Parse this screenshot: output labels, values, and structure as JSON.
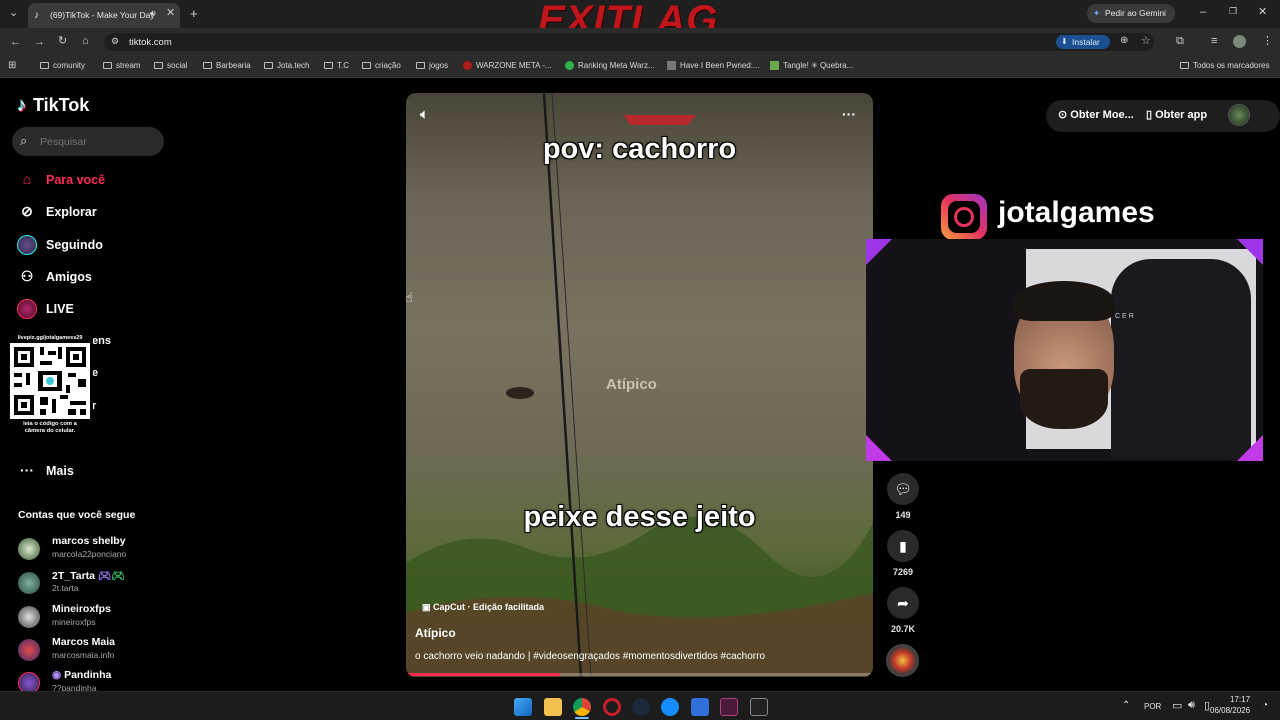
{
  "browser": {
    "tab_title": "(69)TikTok - Make Your Day",
    "url": "tiktok.com",
    "install_label": "Instalar",
    "gemini_label": "Pedir ao Gemini",
    "bookmarks": [
      "comunity",
      "stream",
      "social",
      "Barbearia",
      "Jota.tech",
      "T.C",
      "criação",
      "jogos",
      "WARZONE META -...",
      "Ranking Meta Warz...",
      "Have I Been Pwned:...",
      "Tangle! ✳ Quebra..."
    ],
    "all_bookmarks_label": "Todos os marcadores"
  },
  "overlay": {
    "brand_logo": "EXITLAG",
    "instagram_handle": "jotalgames",
    "webcam_cam_text": "CER",
    "qr_url": "livepix.gg/jotalgamess29",
    "qr_caption": "leia o código com a câmera do celular."
  },
  "sidebar": {
    "logo_text": "TikTok",
    "search_placeholder": "Pesquisar",
    "nav": {
      "for_you": "Para você",
      "explore": "Explorar",
      "following": "Seguindo",
      "friends": "Amigos",
      "live": "LIVE",
      "partial_1": "ens",
      "partial_2": "e",
      "partial_3": "r",
      "more": "Mais"
    },
    "following_title": "Contas que você segue",
    "accounts": [
      {
        "name": "marcos shelby",
        "handle": "marcola22ponciano"
      },
      {
        "name": "2T_Tarta",
        "handle": "2t.tarta"
      },
      {
        "name": "Mineiroxfps",
        "handle": "mineiroxfps"
      },
      {
        "name": "Marcos Maia",
        "handle": "marcosmaia.info"
      },
      {
        "name": "Pandinha",
        "handle": "??pandinha"
      }
    ]
  },
  "header_right": {
    "coins_label": "Obter Moe...",
    "app_label": "Obter app"
  },
  "video": {
    "caption_top": "pov: cachorro",
    "caption_bottom": "peixe desse jeito",
    "watermark": "Atípico",
    "capcut_label": "CapCut · Edição facilitada",
    "author": "Atípico",
    "description": "o cachorro veio nadando | #videosengraçados #momentosdivertidos #cachorro",
    "progress_fraction": 0.33
  },
  "actions": {
    "comments": "149",
    "saves": "7269",
    "shares": "20.7K"
  },
  "taskbar": {
    "lang": "POR",
    "time": "17:17",
    "date": "06/08/2026"
  },
  "colors": {
    "tiktok_red": "#fe2c55",
    "exitlag_red": "#c0151a",
    "accent_blue": "#1a73e8"
  }
}
